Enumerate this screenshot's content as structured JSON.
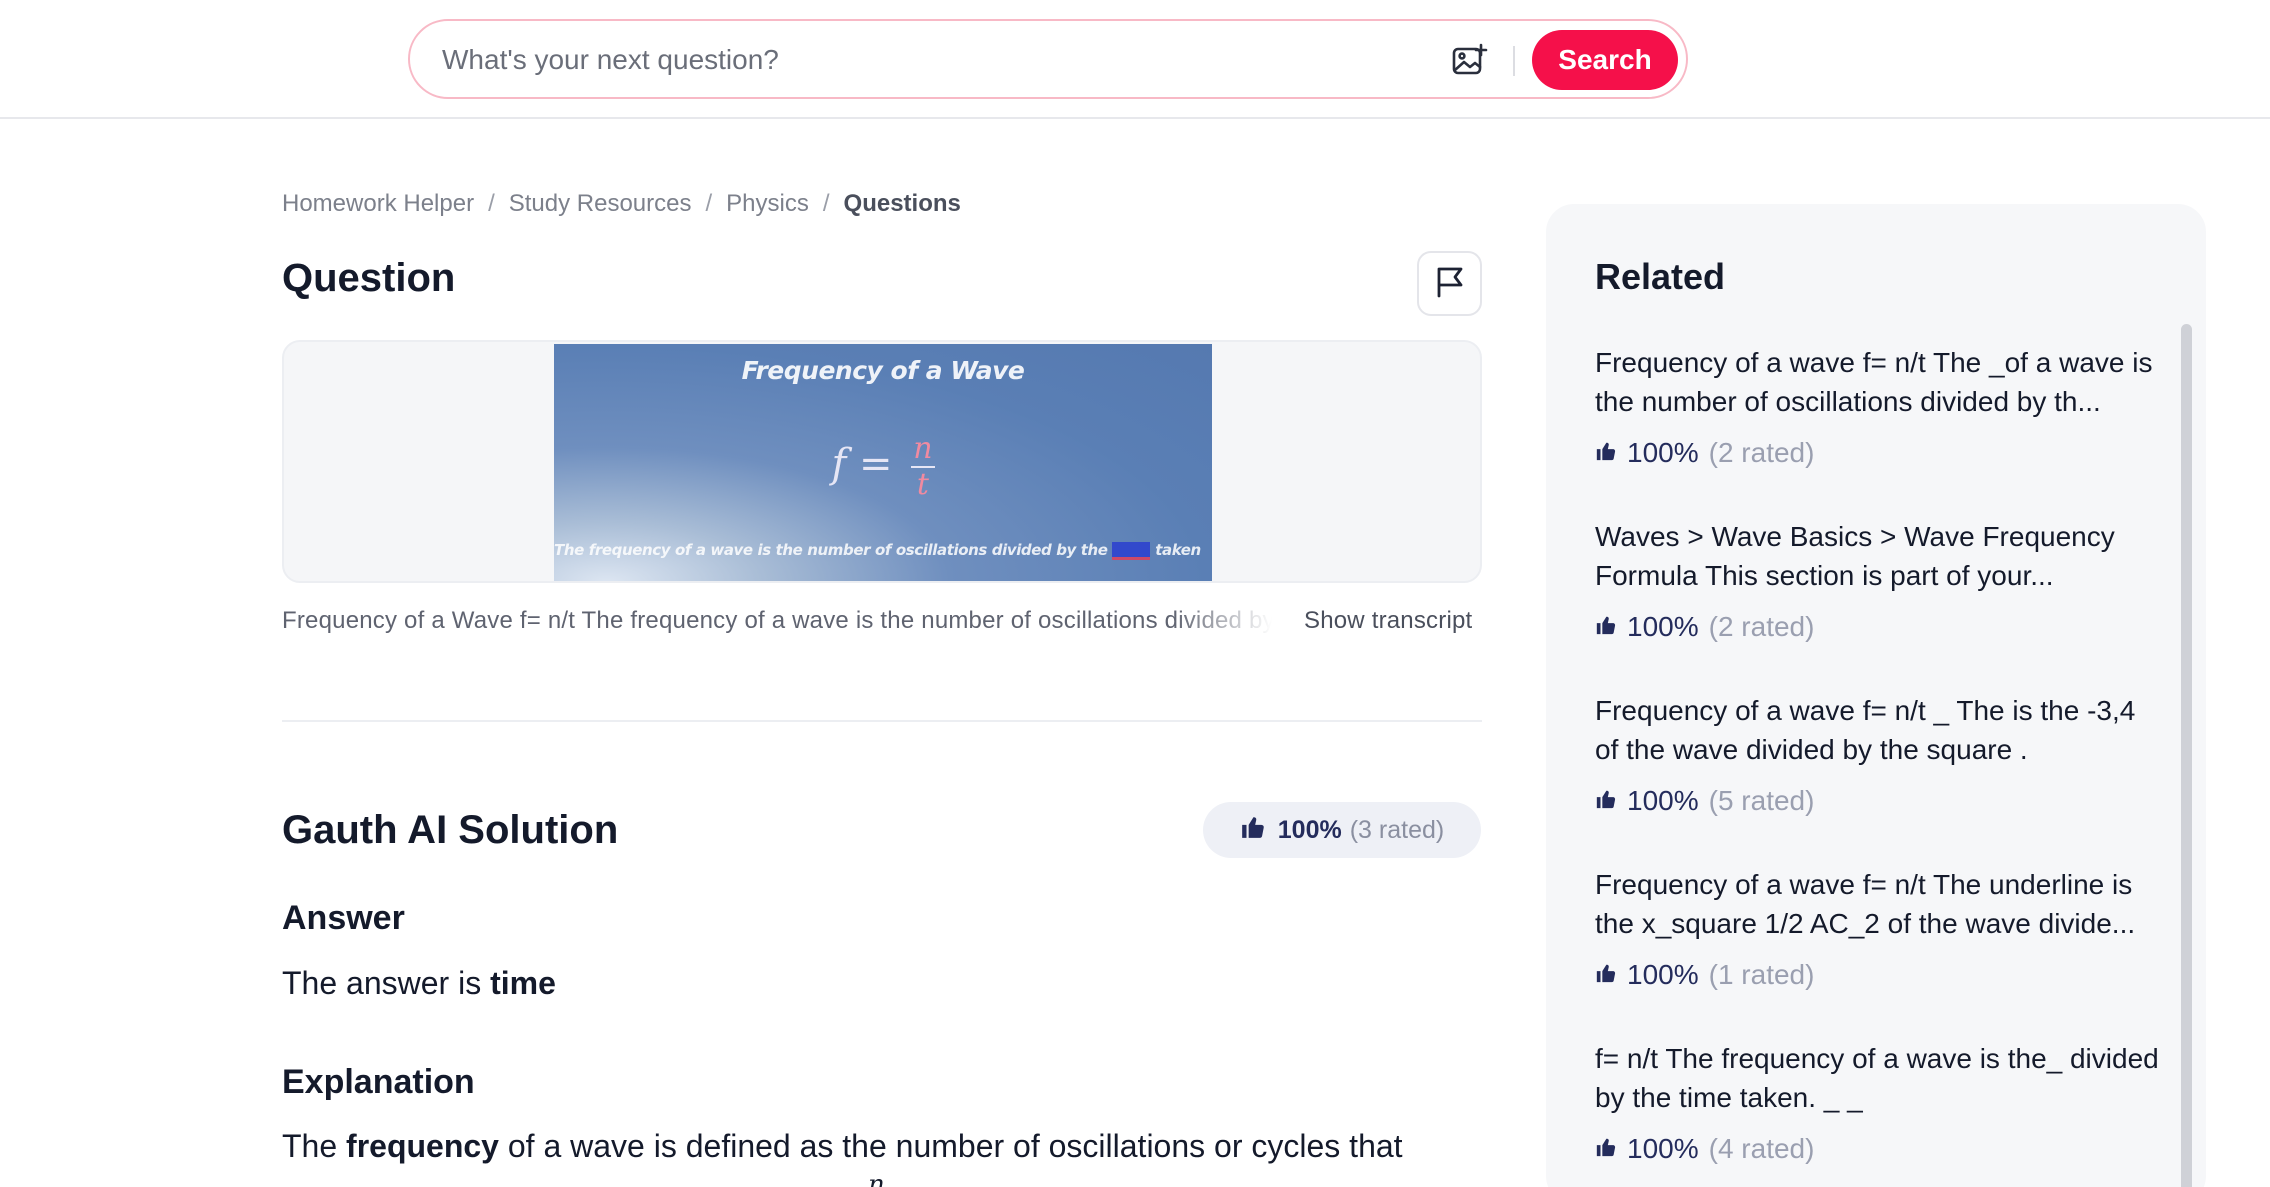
{
  "search": {
    "placeholder": "What's your next question?",
    "button_label": "Search",
    "image_upload_icon": "image-plus-icon"
  },
  "breadcrumb": {
    "items": [
      "Homework Helper",
      "Study Resources",
      "Physics",
      "Questions"
    ],
    "separator": "/"
  },
  "question": {
    "heading": "Question",
    "report_icon": "flag-icon",
    "image": {
      "title": "Frequency of a Wave",
      "formula_lhs": "f =",
      "formula_num": "n",
      "formula_den": "t",
      "caption_before": "The frequency of a wave is the number of oscillations divided by the",
      "caption_after": "taken"
    },
    "transcript": "Frequency of a Wave f= n/t The frequency of a wave is the number of oscillations divided by the ___ taken",
    "show_transcript_label": "Show transcript"
  },
  "solution": {
    "heading": "Gauth AI Solution",
    "rating_icon": "thumbs-up-icon",
    "rating_percent": "100%",
    "rating_count": "(3 rated)",
    "answer_heading": "Answer",
    "answer_prefix": "The answer is ",
    "answer_value": "time",
    "explanation_heading": "Explanation",
    "explanation_prefix": "The ",
    "explanation_bold": "frequency",
    "explanation_rest": " of a wave is defined as the number of oscillations or cycles that",
    "explanation_cut_symbol": "n"
  },
  "related": {
    "heading": "Related",
    "items": [
      {
        "text": "Frequency of a wave f= n/t The _of a wave is the number of oscillations divided by th...",
        "percent": "100%",
        "count": "(2 rated)"
      },
      {
        "text": "Waves > Wave Basics > Wave Frequency Formula This section is part of your...",
        "percent": "100%",
        "count": "(2 rated)"
      },
      {
        "text": "Frequency of a wave f= n/t _ The is the -3,4 of the wave divided by the square .",
        "percent": "100%",
        "count": "(5 rated)"
      },
      {
        "text": "Frequency of a wave f= n/t The underline is the x_square 1/2 AC_2 of the wave divide...",
        "percent": "100%",
        "count": "(1 rated)"
      },
      {
        "text": "f= n/t The frequency of a wave is the_ divided by the time taken. _ _",
        "percent": "100%",
        "count": "(4 rated)"
      }
    ]
  },
  "colors": {
    "accent": "#f5104a",
    "search_border": "#f8b9c6",
    "rating_text": "#242c5c",
    "panel_bg": "#f6f7f9"
  }
}
